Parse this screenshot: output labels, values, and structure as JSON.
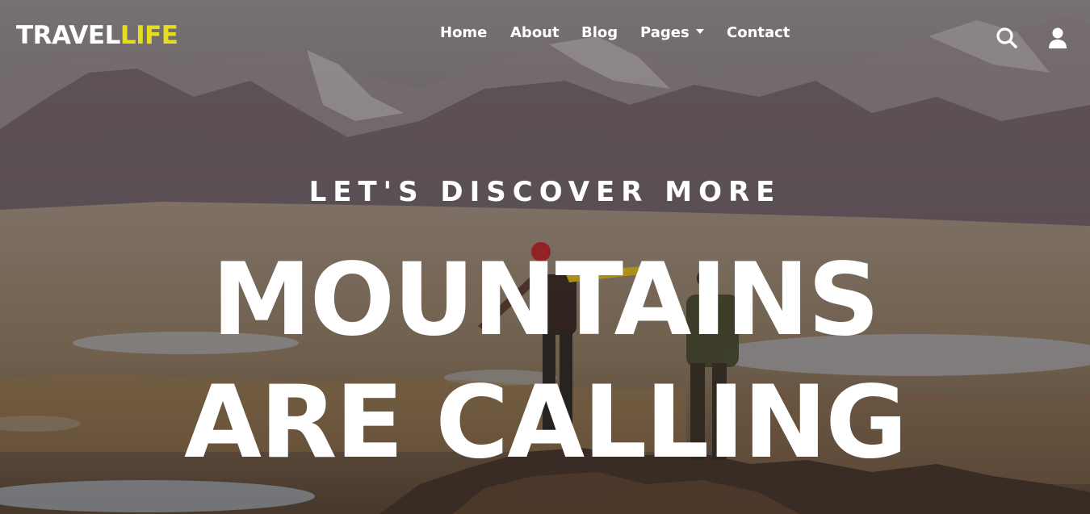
{
  "brand": {
    "part1": "TRAVEL",
    "part2": "LIFE"
  },
  "nav": {
    "home": "Home",
    "about": "About",
    "blog": "Blog",
    "pages": "Pages",
    "contact": "Contact"
  },
  "icons": {
    "search": "search-icon",
    "user": "user-icon",
    "dropdown": "caret-down-icon"
  },
  "hero": {
    "subtitle": "LET'S DISCOVER MORE",
    "line1": "MOUNTAINS",
    "line2": "ARE CALLING"
  },
  "colors": {
    "accent": "#e6dd1f",
    "text": "#ffffff"
  }
}
